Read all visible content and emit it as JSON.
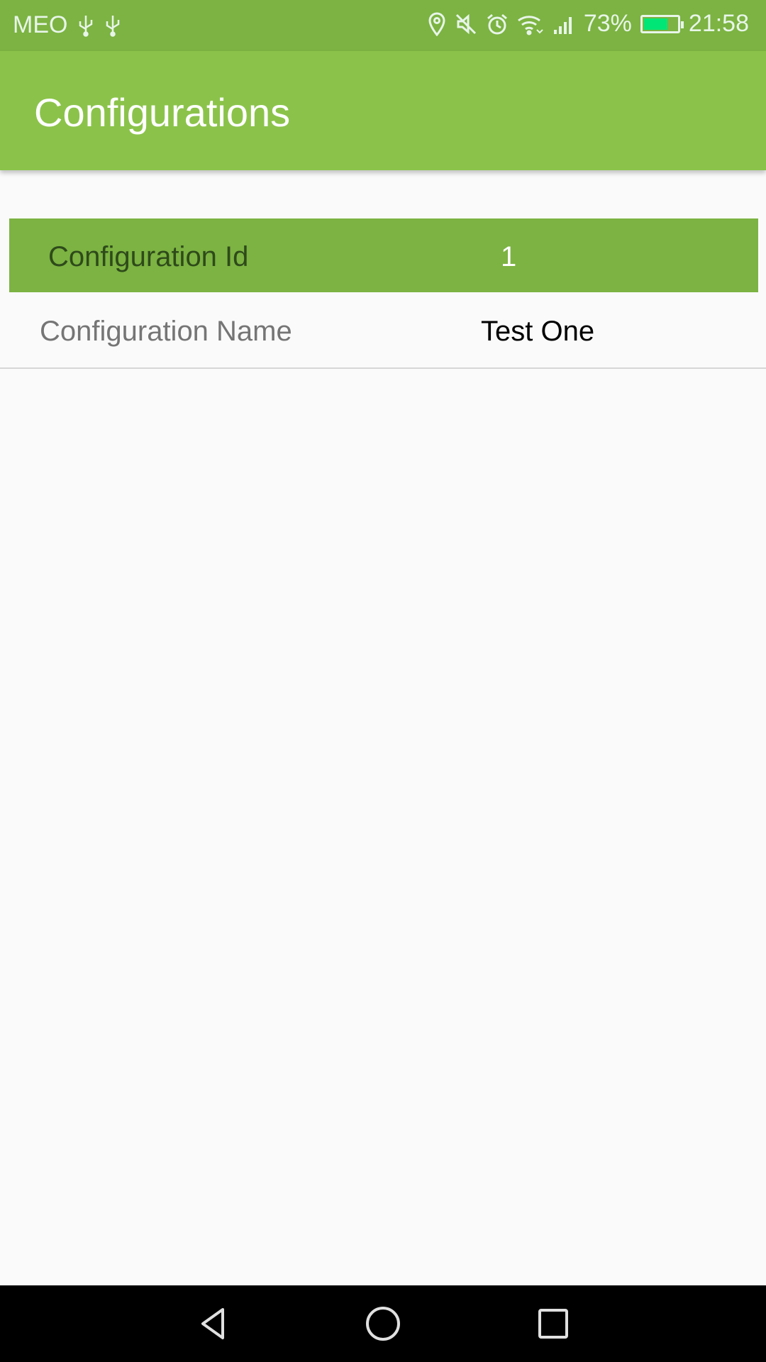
{
  "status_bar": {
    "carrier": "MEO",
    "battery_percent": "73%",
    "time": "21:58",
    "battery_level": 0.73,
    "icons": [
      "usb-icon",
      "usb-icon",
      "location-icon",
      "mute-icon",
      "alarm-icon",
      "wifi-icon",
      "signal-icon",
      "battery-icon"
    ]
  },
  "app_bar": {
    "title": "Configurations"
  },
  "config": {
    "id_label": "Configuration Id",
    "id_value": "1",
    "name_label": "Configuration Name",
    "name_value": "Test One"
  },
  "nav_bar": {
    "icons": [
      "back-icon",
      "home-icon",
      "recents-icon"
    ]
  },
  "colors": {
    "status_bar": "#7cb342",
    "app_bar": "#8bc34a",
    "highlight_row": "#7cb342",
    "background": "#fafafa",
    "battery_fill": "#00e676"
  }
}
